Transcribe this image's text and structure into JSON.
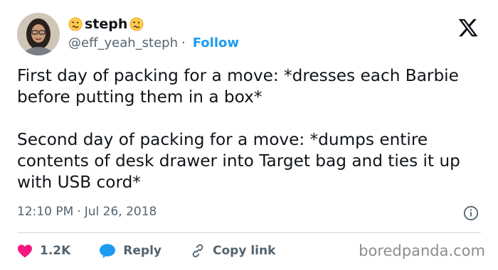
{
  "author": {
    "display_name": "steph",
    "handle": "@eff_yeah_steph",
    "follow_label": "Follow",
    "name_emoji": "woozy-face-icon"
  },
  "tweet": {
    "text": "First day of packing for a move: *dresses each Barbie before putting them in a box*\n\nSecond day of packing for a move: *dumps entire contents of desk drawer into Target bag and ties it up with USB cord*",
    "time": "12:10 PM",
    "date": "Jul 26, 2018"
  },
  "actions": {
    "likes": "1.2K",
    "reply_label": "Reply",
    "copy_link_label": "Copy link"
  },
  "watermark": "boredpanda.com",
  "colors": {
    "follow": "#1d9bf0",
    "like": "#f91880",
    "reply": "#1d9bf0",
    "muted": "#536471"
  }
}
